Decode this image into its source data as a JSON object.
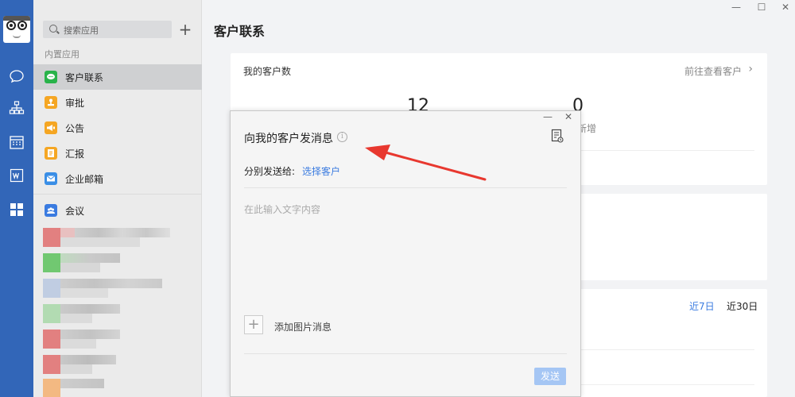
{
  "sidebar": {
    "search_placeholder": "搜索应用",
    "section_label": "内置应用",
    "apps": [
      {
        "label": "客户联系",
        "color": "#29b34a"
      },
      {
        "label": "审批",
        "color": "#f5a623"
      },
      {
        "label": "公告",
        "color": "#f5a623"
      },
      {
        "label": "汇报",
        "color": "#f5a623"
      },
      {
        "label": "企业邮箱",
        "color": "#3a8ee6"
      },
      {
        "label": "会议",
        "color": "#3a7be0"
      }
    ]
  },
  "main": {
    "title": "客户联系",
    "card1": {
      "title": "我的客户数",
      "more_link": "前往查看客户",
      "stat1": "12",
      "stat2": "0",
      "stat2_label": "新增"
    },
    "range_tabs": [
      "近7日",
      "近30日"
    ]
  },
  "dialog": {
    "title": "向我的客户发消息",
    "info_icon_char": "i",
    "to_label": "分别发送给:",
    "to_link": "选择客户",
    "text_placeholder": "在此输入文字内容",
    "add_image_label": "添加图片消息",
    "send_label": "发送",
    "minimize_char": "—",
    "close_char": "✕"
  },
  "window": {
    "minimize_char": "—",
    "maximize_char": "☐",
    "close_char": "✕"
  },
  "colors": {
    "rail": "#3266b8",
    "accent": "#3a7be0",
    "arrow": "#e8382f"
  }
}
